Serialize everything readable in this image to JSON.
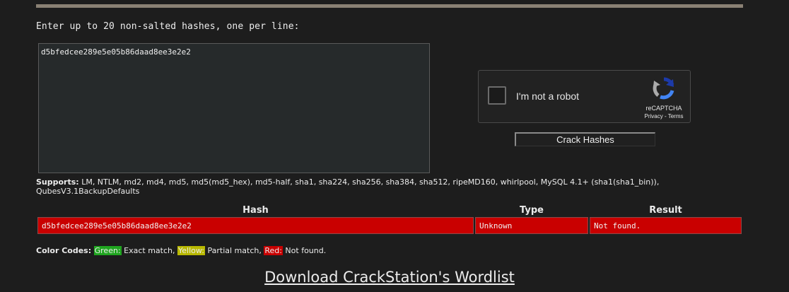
{
  "instructions": "Enter up to 20 non-salted hashes, one per line:",
  "hash_input": {
    "value": "d5bfedcee289e5e05b86daad8ee3e2e2"
  },
  "captcha": {
    "label": "I'm not a robot",
    "brand": "reCAPTCHA",
    "links": "Privacy - Terms",
    "icon": "recaptcha-icon"
  },
  "crack_button": {
    "label": "Crack Hashes"
  },
  "supports": {
    "label": "Supports:",
    "text": " LM, NTLM, md2, md4, md5, md5(md5_hex), md5-half, sha1, sha224, sha256, sha384, sha512, ripeMD160, whirlpool, MySQL 4.1+ (sha1(sha1_bin)), QubesV3.1BackupDefaults"
  },
  "results": {
    "headers": [
      "Hash",
      "Type",
      "Result"
    ],
    "rows": [
      {
        "hash": "d5bfedcee289e5e05b86daad8ee3e2e2",
        "type": "Unknown",
        "result": "Not found.",
        "status_color": "#c90000"
      }
    ]
  },
  "color_codes": {
    "label": "Color Codes:",
    "green": {
      "name": "Green:",
      "desc": " Exact match, ",
      "color": "#1fa51f"
    },
    "yellow": {
      "name": "Yellow:",
      "desc": " Partial match, ",
      "color": "#b8b800"
    },
    "red": {
      "name": "Red:",
      "desc": " Not found.",
      "color": "#c90000"
    }
  },
  "download_link": "Download CrackStation's Wordlist",
  "colors": {
    "background": "#1d1d1d",
    "rule": "#8a8174",
    "not_found": "#c90000"
  }
}
